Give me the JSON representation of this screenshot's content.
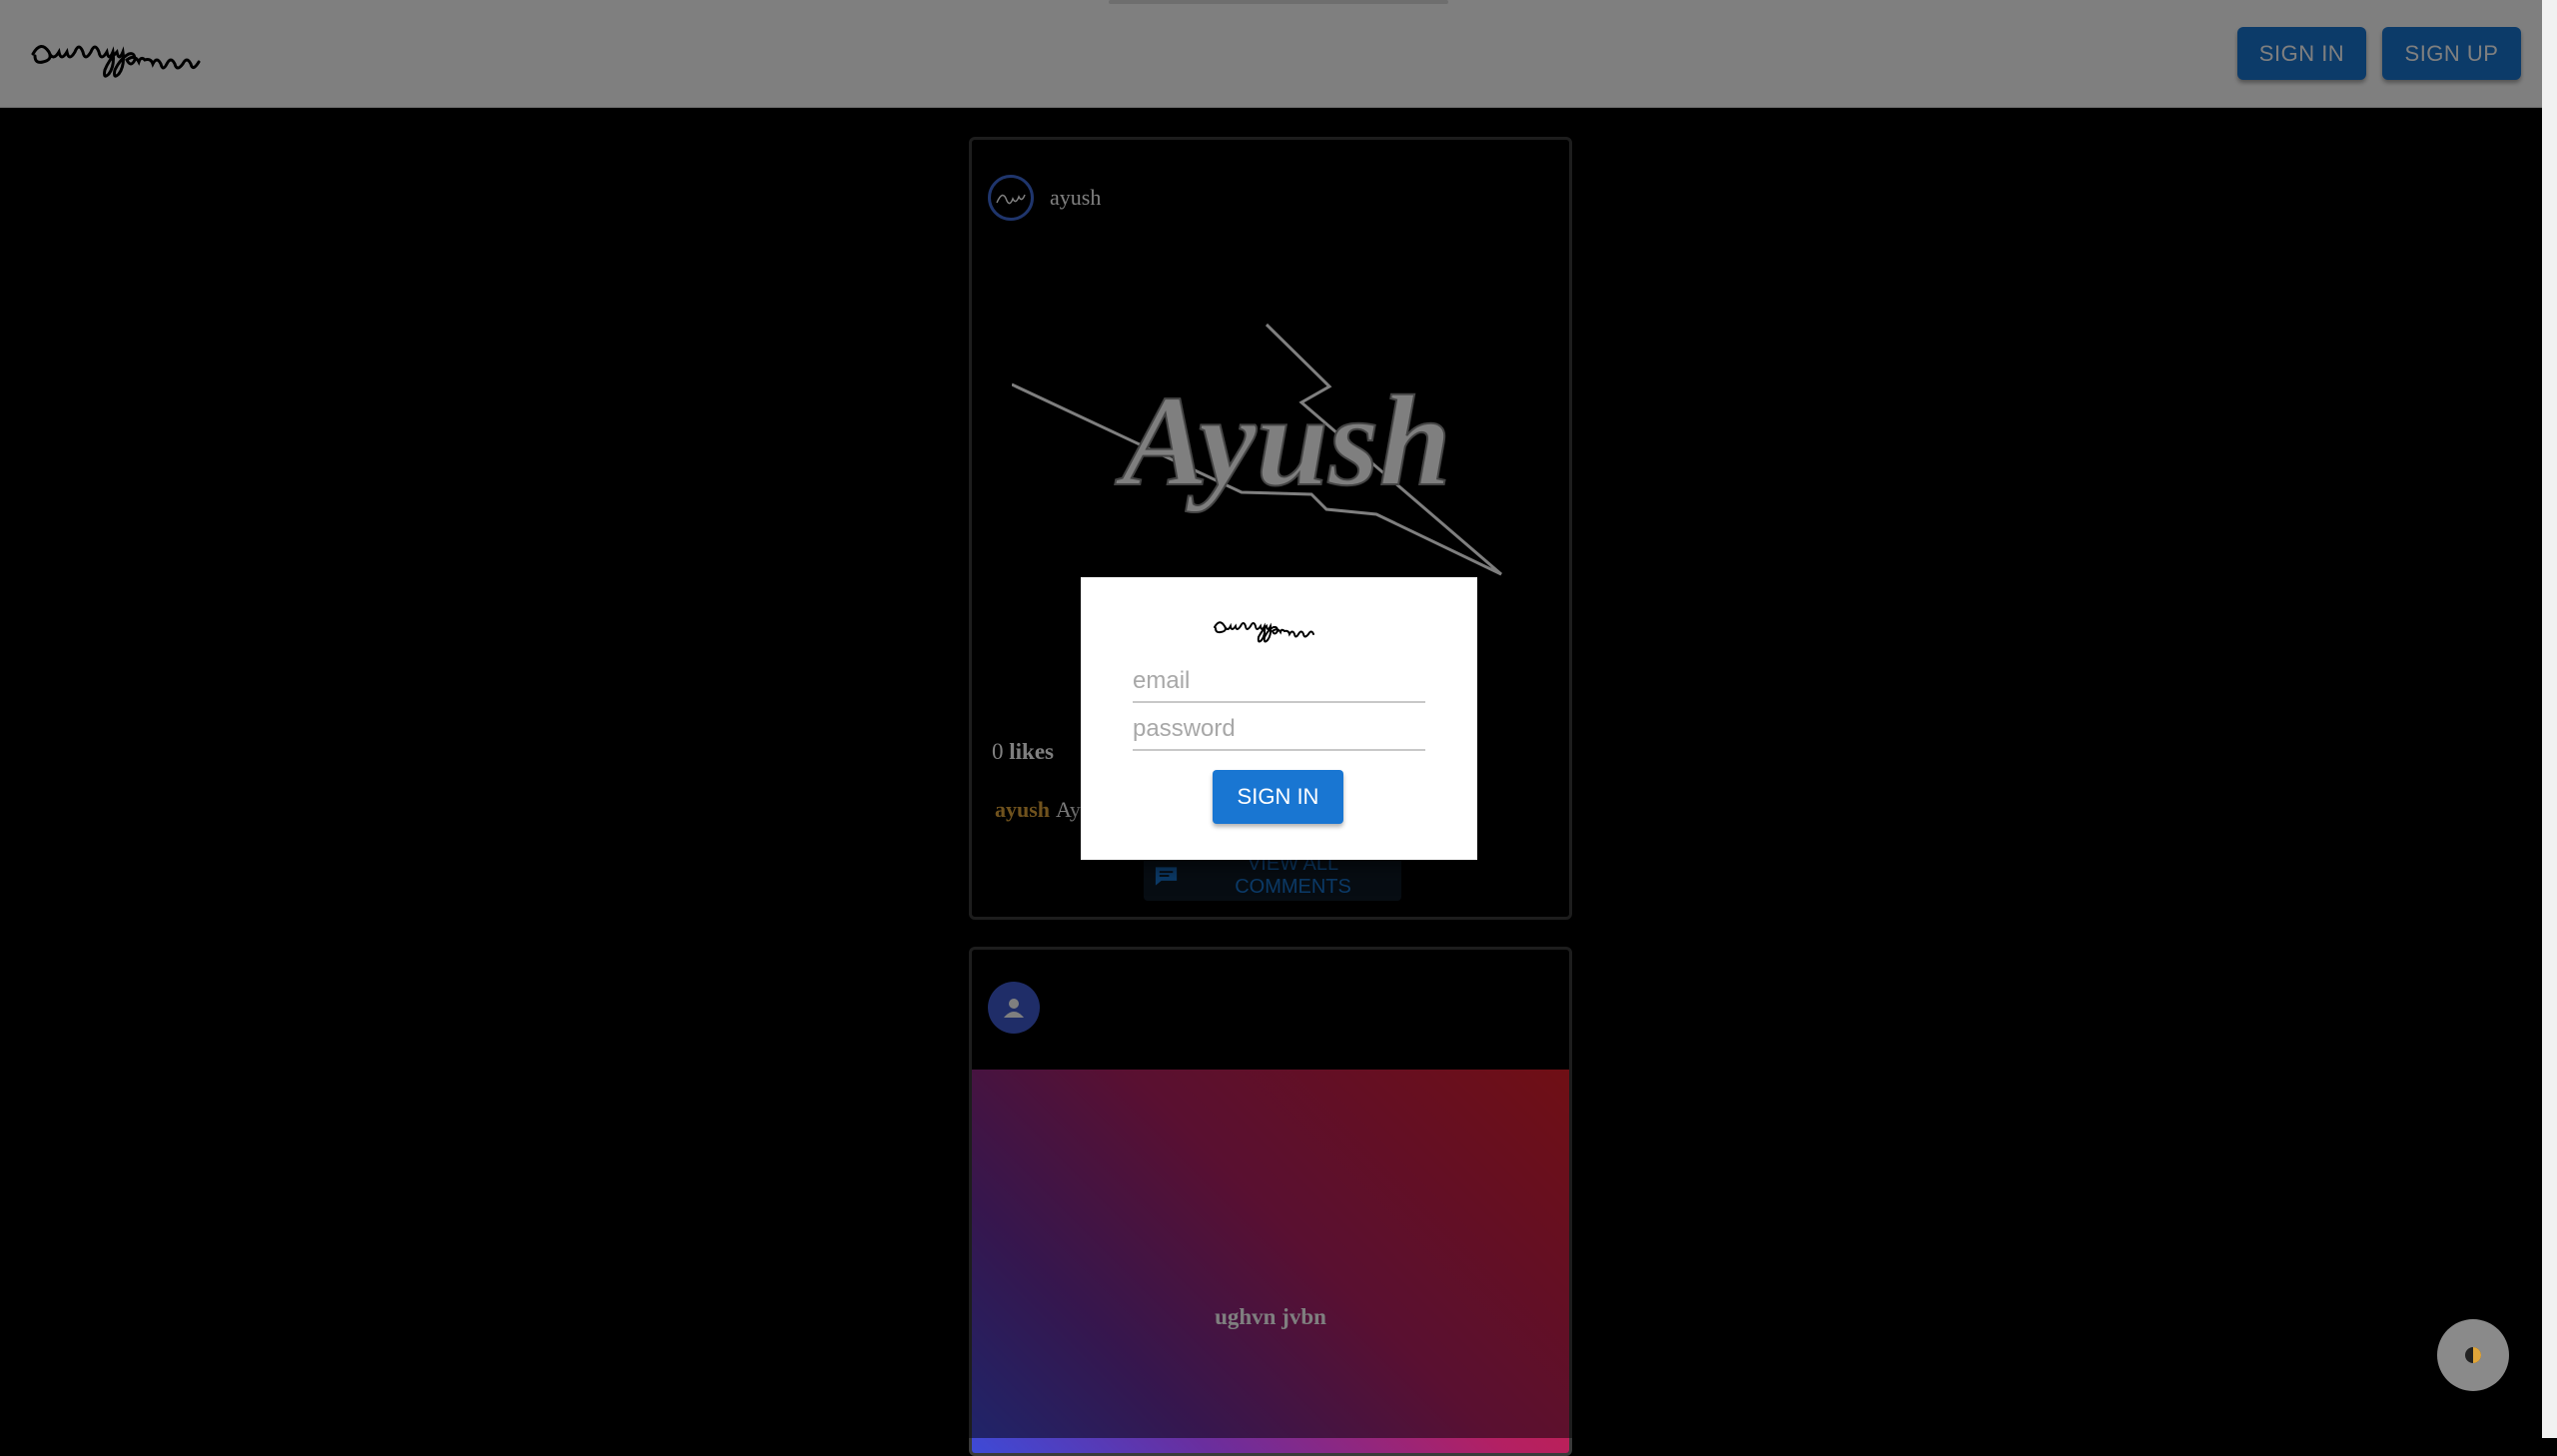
{
  "header": {
    "signin_label": "SIGN IN",
    "signup_label": "SIGN UP"
  },
  "posts": [
    {
      "username": "ayush",
      "likes_count": "0",
      "likes_label": "likes",
      "caption_user": "ayush",
      "caption_text": "Ay",
      "view_comments_label": "VIEW ALL COMMENTS",
      "image_text": "Ayush"
    },
    {
      "username": "",
      "gradient_text": "ughvn jvbn"
    }
  ],
  "modal": {
    "email_placeholder": "email",
    "password_placeholder": "password",
    "signin_label": "SIGN IN"
  },
  "icons": {
    "logo": "dummygram-logo",
    "comment": "comment-icon",
    "person": "person-icon",
    "theme": "theme-toggle-icon"
  },
  "colors": {
    "primary": "#1976d2",
    "caption_user": "#e0a53a",
    "avatar_blue": "#3f5bd0"
  }
}
